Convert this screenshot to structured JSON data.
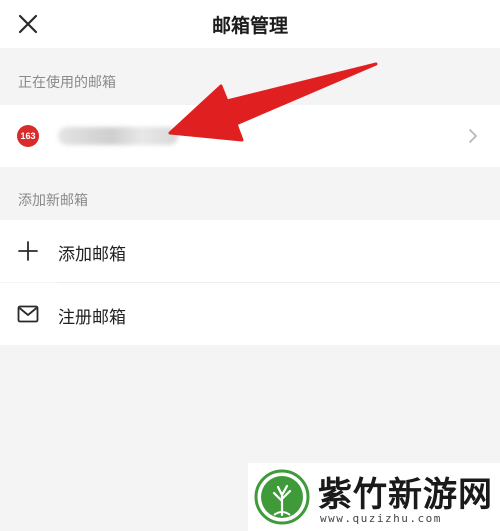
{
  "header": {
    "title": "邮箱管理"
  },
  "current_section": {
    "label": "正在使用的邮箱",
    "account": {
      "badge": "163",
      "icon": "mailbox-163-logo-icon"
    }
  },
  "add_section": {
    "label": "添加新邮箱",
    "items": [
      {
        "label": "添加邮箱",
        "icon": "plus-icon"
      },
      {
        "label": "注册邮箱",
        "icon": "envelope-icon"
      }
    ]
  },
  "watermark": {
    "title": "紫竹新游网",
    "url": "www.quzizhu.com"
  },
  "colors": {
    "background": "#f4f4f5",
    "arrow": "#e02020",
    "badge": "#d92b2b",
    "watermark_green": "#3f9a3a"
  }
}
